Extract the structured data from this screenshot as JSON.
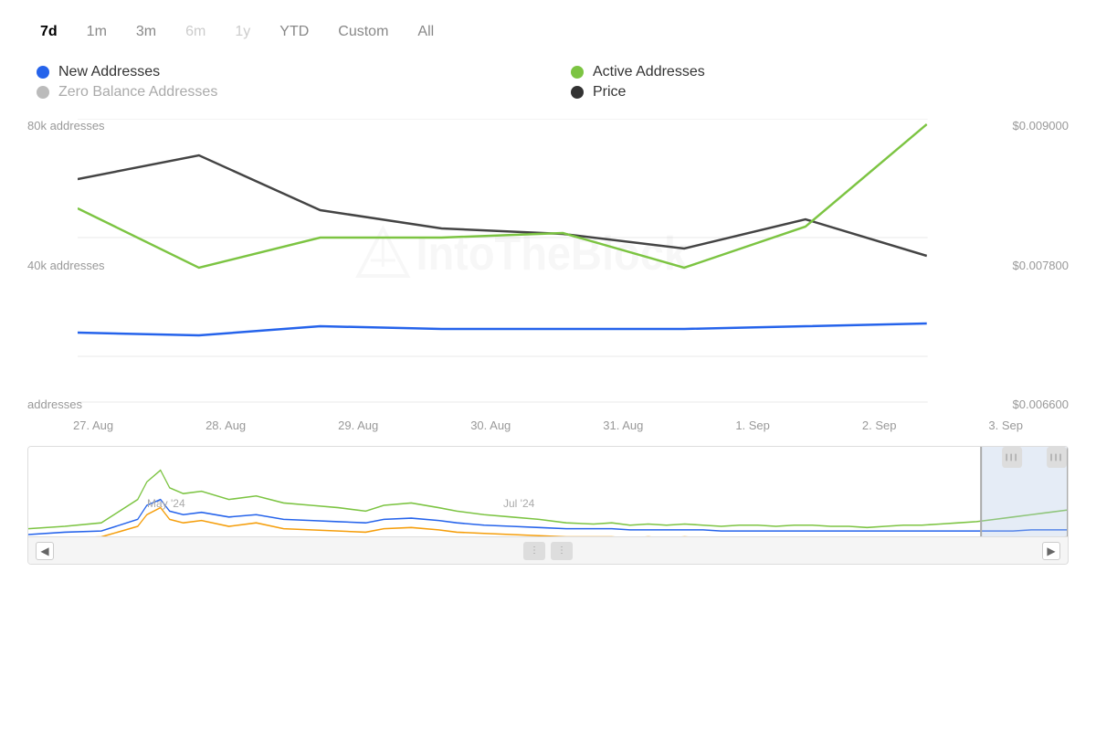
{
  "timeRange": {
    "options": [
      {
        "label": "7d",
        "value": "7d",
        "state": "active"
      },
      {
        "label": "1m",
        "value": "1m",
        "state": "normal"
      },
      {
        "label": "3m",
        "value": "3m",
        "state": "normal"
      },
      {
        "label": "6m",
        "value": "6m",
        "state": "disabled"
      },
      {
        "label": "1y",
        "value": "1y",
        "state": "disabled"
      },
      {
        "label": "YTD",
        "value": "ytd",
        "state": "normal"
      },
      {
        "label": "Custom",
        "value": "custom",
        "state": "normal"
      },
      {
        "label": "All",
        "value": "all",
        "state": "normal"
      }
    ]
  },
  "legend": {
    "items": [
      {
        "label": "New Addresses",
        "color": "#2563eb",
        "active": true,
        "position": "left"
      },
      {
        "label": "Active Addresses",
        "color": "#7cc442",
        "active": true,
        "position": "right"
      },
      {
        "label": "Zero Balance Addresses",
        "color": "#bbb",
        "active": false,
        "position": "left"
      },
      {
        "label": "Price",
        "color": "#333",
        "active": true,
        "position": "right"
      }
    ]
  },
  "yAxis": {
    "left": {
      "labels": [
        "80k addresses",
        "40k addresses",
        "addresses"
      ]
    },
    "right": {
      "labels": [
        "$0.009000",
        "$0.007800",
        "$0.006600"
      ]
    }
  },
  "xAxis": {
    "labels": [
      "27. Aug",
      "28. Aug",
      "29. Aug",
      "30. Aug",
      "31. Aug",
      "1. Sep",
      "2. Sep",
      "3. Sep"
    ]
  },
  "miniChart": {
    "labels": [
      "May '24",
      "Jul '24"
    ],
    "labelPositions": [
      140,
      540
    ]
  },
  "watermark": "IntoTheBlock",
  "colors": {
    "newAddresses": "#2563eb",
    "activeAddresses": "#7cc442",
    "zeroBalance": "#bbb",
    "price": "#444",
    "gridLine": "#e8e8e8"
  }
}
